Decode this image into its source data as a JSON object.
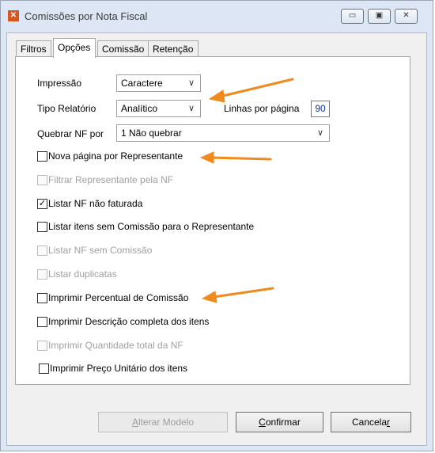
{
  "window": {
    "title": "Comissões por Nota Fiscal",
    "icon_name": "app-icon",
    "controls": [
      "minimize-icon",
      "maximize-icon",
      "close-icon"
    ]
  },
  "tabs": [
    {
      "label": "Filtros",
      "active": false
    },
    {
      "label": "Opções",
      "active": true
    },
    {
      "label": "Comissão",
      "active": false
    },
    {
      "label": "Retenção",
      "active": false
    }
  ],
  "options": {
    "impressao": {
      "label": "Impressão",
      "value": "Caractere"
    },
    "tipo_relatorio": {
      "label": "Tipo Relatório",
      "value": "Analítico"
    },
    "linhas": {
      "label": "Linhas por página",
      "value": "90"
    },
    "quebrar": {
      "label": "Quebrar NF por",
      "value": "1 Não quebrar"
    }
  },
  "checkboxes": [
    {
      "label": "Nova página por Representante",
      "checked": false,
      "enabled": true
    },
    {
      "label": "Filtrar Representante pela NF",
      "checked": false,
      "enabled": false
    },
    {
      "label": "Listar NF não faturada",
      "checked": true,
      "enabled": true
    },
    {
      "label": "Listar itens sem Comissão para o Representante",
      "checked": false,
      "enabled": true
    },
    {
      "label": "Listar NF sem Comissão",
      "checked": false,
      "enabled": false
    },
    {
      "label": "Listar duplicatas",
      "checked": false,
      "enabled": false
    },
    {
      "label": "Imprimir Percentual de Comissão",
      "checked": false,
      "enabled": true
    },
    {
      "label": "Imprimir Descrição completa dos itens",
      "checked": false,
      "enabled": true
    },
    {
      "label": "Imprimir Quantidade total da NF",
      "checked": false,
      "enabled": false
    },
    {
      "label": "Imprimir Preço Unitário dos itens",
      "checked": false,
      "enabled": true
    }
  ],
  "buttons": {
    "alterar": {
      "pre": "",
      "u": "A",
      "post": "lterar Modelo",
      "enabled": false
    },
    "confirmar": {
      "pre": "",
      "u": "C",
      "post": "onfirmar",
      "enabled": true
    },
    "cancelar": {
      "pre": "Cancela",
      "u": "r",
      "post": "",
      "enabled": true
    }
  },
  "colors": {
    "annotation_arrow": "#f08a1c",
    "number_text": "#0033aa"
  }
}
